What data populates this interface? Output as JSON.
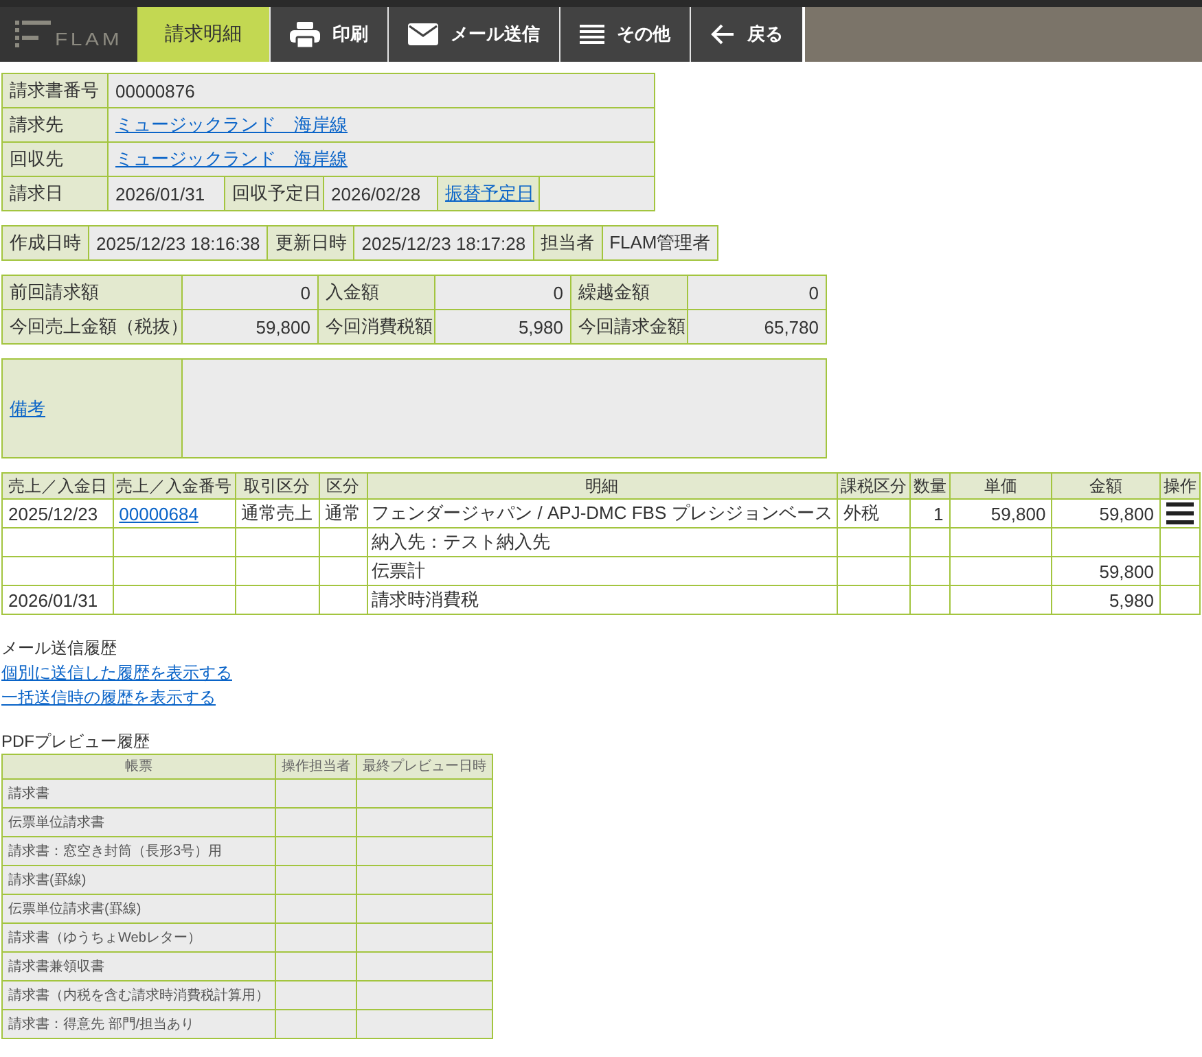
{
  "toolbar": {
    "logo": "FLAM",
    "items": [
      {
        "kind": "tab",
        "label": "請求明細",
        "selected": true
      },
      {
        "kind": "print",
        "label": "印刷",
        "selected": false
      },
      {
        "kind": "mail",
        "label": "メール送信",
        "selected": false
      },
      {
        "kind": "list",
        "label": "その他",
        "selected": false
      },
      {
        "kind": "back",
        "label": "戻る",
        "selected": false
      }
    ]
  },
  "invoice": {
    "rows": [
      [
        {
          "kind": "label",
          "text": "請求書番号"
        },
        {
          "kind": "value",
          "text": "00000876",
          "colspan": 5
        }
      ],
      [
        {
          "kind": "label",
          "text": "請求先"
        },
        {
          "kind": "link",
          "text": "ミュージックランド　海岸線",
          "colspan": 5
        }
      ],
      [
        {
          "kind": "label",
          "text": "回収先"
        },
        {
          "kind": "link",
          "text": "ミュージックランド　海岸線",
          "colspan": 5
        }
      ],
      [
        {
          "kind": "label",
          "text": "請求日"
        },
        {
          "kind": "value",
          "text": "2026/01/31"
        },
        {
          "kind": "label",
          "text": "回収予定日"
        },
        {
          "kind": "value",
          "text": "2026/02/28"
        },
        {
          "kind": "label_link",
          "text": "振替予定日"
        },
        {
          "kind": "blank"
        }
      ]
    ]
  },
  "meta": {
    "rows": [
      [
        {
          "kind": "label",
          "text": "作成日時"
        },
        {
          "kind": "value",
          "text": "2025/12/23 18:16:38"
        },
        {
          "kind": "label",
          "text": "更新日時"
        },
        {
          "kind": "value",
          "text": "2025/12/23 18:17:28"
        },
        {
          "kind": "label",
          "text": "担当者"
        },
        {
          "kind": "value",
          "text": "FLAM管理者"
        }
      ]
    ]
  },
  "totals": {
    "rows": [
      [
        {
          "kind": "label",
          "text": "前回請求額"
        },
        {
          "kind": "amount",
          "text": "0"
        },
        {
          "kind": "label",
          "text": "入金額"
        },
        {
          "kind": "amount",
          "text": "0"
        },
        {
          "kind": "label",
          "text": "繰越金額"
        },
        {
          "kind": "amount",
          "text": "0"
        }
      ],
      [
        {
          "kind": "label",
          "text": "今回売上金額（税抜）"
        },
        {
          "kind": "amount",
          "text": "59,800"
        },
        {
          "kind": "label",
          "text": "今回消費税額"
        },
        {
          "kind": "amount",
          "text": "5,980"
        },
        {
          "kind": "label",
          "text": "今回請求金額"
        },
        {
          "kind": "amount",
          "text": "65,780"
        }
      ]
    ]
  },
  "remarks": {
    "rows": [
      [
        {
          "kind": "label_link",
          "text": "備考"
        },
        {
          "kind": "blank"
        }
      ]
    ]
  },
  "lines": {
    "columns": [
      "売上／入金日",
      "売上／入金番号",
      "取引区分",
      "区分",
      "明細",
      "課税区分",
      "数量",
      "単価",
      "金額",
      "操作"
    ],
    "rows": [
      {
        "date": "2025/12/23",
        "number": "00000684",
        "trade_type": "通常売上",
        "category": "通常",
        "detail": "フェンダージャパン / APJ-DMC FBS プレシジョンベース",
        "tax_type": "外税",
        "quantity": "1",
        "unit_price": "59,800",
        "amount": "59,800",
        "menu": true
      },
      {
        "detail": "納入先：テスト納入先",
        "menu": false
      },
      {
        "detail": "伝票計",
        "amount": "59,800",
        "menu": false
      },
      {
        "date": "2026/01/31",
        "detail": "請求時消費税",
        "amount": "5,980",
        "menu": false
      }
    ]
  },
  "mail_history": {
    "title": "メール送信履歴",
    "links": [
      "個別に送信した履歴を表示する",
      "一括送信時の履歴を表示する"
    ]
  },
  "pdf_history": {
    "title": "PDFプレビュー履歴",
    "columns": [
      "帳票",
      "操作担当者",
      "最終プレビュー日時"
    ],
    "rows": [
      {
        "form": "請求書"
      },
      {
        "form": "伝票単位請求書"
      },
      {
        "form": "請求書：窓空き封筒（長形3号）用"
      },
      {
        "form": "請求書(罫線)"
      },
      {
        "form": "伝票単位請求書(罫線)"
      },
      {
        "form": "請求書（ゆうちょWebレター）"
      },
      {
        "form": "請求書兼領収書"
      },
      {
        "form": "請求書（内税を含む請求時消費税計算用）"
      },
      {
        "form": "請求書：得意先 部門/担当あり"
      }
    ]
  }
}
